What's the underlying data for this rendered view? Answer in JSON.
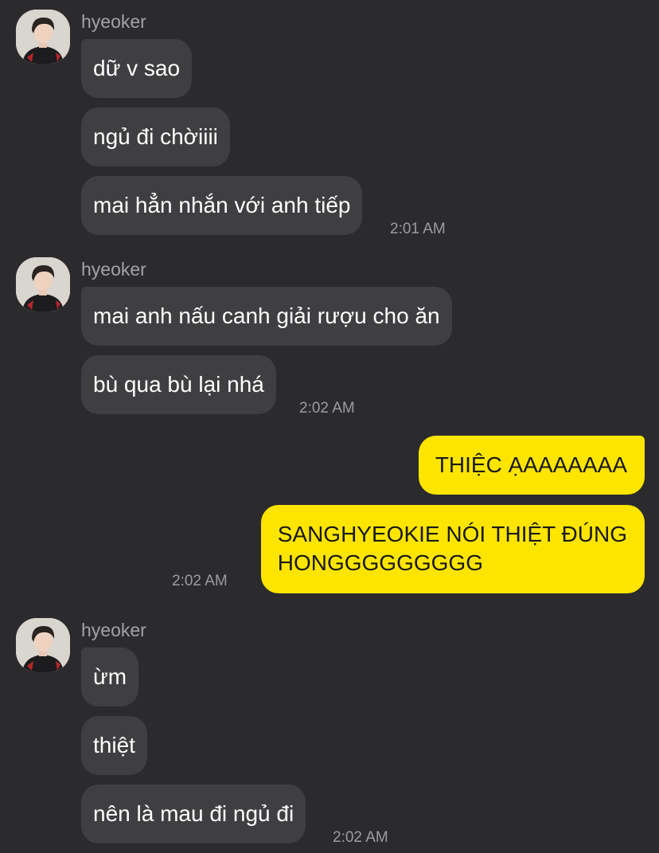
{
  "theme": {
    "background": "#2b2b2d",
    "incoming_bubble": "#3f3f42",
    "outgoing_bubble": "#fee500",
    "timestamp_color": "#9c9ca0"
  },
  "groups": [
    {
      "sender": "hyeoker",
      "avatar_icon": "profile-photo",
      "messages": [
        "dữ v sao",
        "ngủ đi chờiiii",
        "mai hẳn nhắn với anh tiếp"
      ],
      "time": "2:01 AM"
    },
    {
      "sender": "hyeoker",
      "avatar_icon": "profile-photo",
      "messages": [
        "mai anh nấu canh giải rượu cho ăn",
        "bù qua bù lại nhá"
      ],
      "time": "2:02 AM"
    },
    {
      "sender": "me",
      "messages": [
        "THIỆC ẠAAAAAAA",
        "SANGHYEOKIE NÓI THIỆT ĐÚNG",
        "HONGGGGGGGGG"
      ],
      "time": "2:02 AM"
    },
    {
      "sender": "hyeoker",
      "avatar_icon": "profile-photo",
      "messages": [
        "ừm",
        "thiệt",
        "nên là mau đi ngủ đi"
      ],
      "time": "2:02 AM"
    }
  ]
}
